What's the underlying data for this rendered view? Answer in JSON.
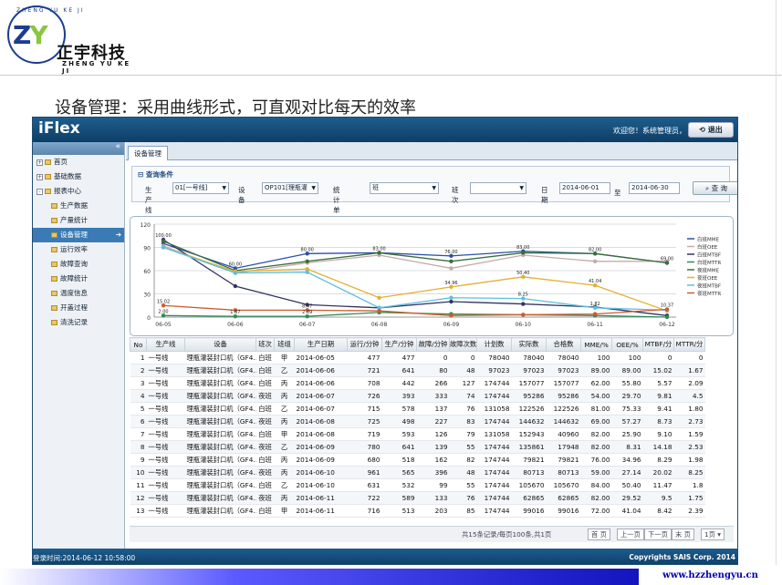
{
  "logo": {
    "arc_text": "ZHENG YU KE JI",
    "letters_z": "Z",
    "letters_y": "Y",
    "cn": "正宇科技",
    "en": "ZHENG YU KE JI"
  },
  "caption": "设备管理：采用曲线形式，可直观对比每天的效率",
  "app": {
    "brand": "iFlex",
    "welcome": "欢迎您！系统管理员，",
    "logout": "退出",
    "sidebar": {
      "collapse": "«",
      "items": [
        {
          "label": "首页",
          "level": 0,
          "toggle": "+"
        },
        {
          "label": "基础数据",
          "level": 0,
          "toggle": "+"
        },
        {
          "label": "报表中心",
          "level": 0,
          "toggle": "-"
        },
        {
          "label": "生产数据",
          "level": 1
        },
        {
          "label": "产量统计",
          "level": 1
        },
        {
          "label": "设备管理",
          "level": 1,
          "active": true
        },
        {
          "label": "运行效率",
          "level": 1
        },
        {
          "label": "故障查询",
          "level": 1
        },
        {
          "label": "故障统计",
          "level": 1
        },
        {
          "label": "温度信息",
          "level": 1
        },
        {
          "label": "开盖过程",
          "level": 1
        },
        {
          "label": "清洗记录",
          "level": 1
        }
      ]
    },
    "tab": "设备管理",
    "query": {
      "title": "查询条件",
      "line_label": "生产线",
      "line_value": "01[一号线]",
      "device_label": "设 备",
      "device_value": "OP101[理瓶灌",
      "unit_label": "统计单位",
      "unit_value": "班",
      "shift_label": "班次",
      "shift_value": "",
      "date_label": "日期",
      "date_from": "2014-06-01",
      "date_sep": "至",
      "date_to": "2014-06-30",
      "search": "查 询"
    },
    "chart_data": {
      "type": "line",
      "categories": [
        "06-05",
        "06-06",
        "06-07",
        "06-08",
        "06-09",
        "06-10",
        "06-11",
        "06-12"
      ],
      "ylim": [
        0,
        120
      ],
      "yticks": [
        0,
        30,
        60,
        90,
        120
      ],
      "grid": true,
      "legend_position": "right",
      "series": [
        {
          "name": "白班MME",
          "color": "#2b4fa8",
          "values": [
            95,
            63,
            82,
            83,
            79,
            85,
            82,
            70
          ]
        },
        {
          "name": "白班OEE",
          "color": "#c7a9a9",
          "values": [
            92,
            57,
            70,
            80,
            63,
            80,
            72,
            72
          ]
        },
        {
          "name": "白班MTBF",
          "color": "#333366",
          "values": [
            100,
            40,
            16,
            12,
            20,
            17,
            13,
            2
          ]
        },
        {
          "name": "白班MTTR",
          "color": "#2e8b57",
          "values": [
            2,
            1,
            1,
            6,
            4,
            3,
            2,
            0
          ]
        },
        {
          "name": "夜班MME",
          "color": "#3a6f3a",
          "values": [
            98,
            60,
            72,
            83,
            72,
            83,
            82,
            70
          ]
        },
        {
          "name": "夜班OEE",
          "color": "#e0b030",
          "values": [
            90,
            59,
            62,
            25,
            39,
            52,
            41,
            8
          ]
        },
        {
          "name": "夜班MTBF",
          "color": "#5bc0de",
          "values": [
            90,
            57,
            58,
            12,
            25,
            24,
            12,
            9
          ]
        },
        {
          "name": "夜班MTTR",
          "color": "#d05a2a",
          "values": [
            15,
            9,
            9,
            8,
            2,
            3,
            4,
            10
          ]
        }
      ],
      "data_labels": [
        "100.00",
        "60.00",
        "80.00",
        "83.00",
        "76.00",
        "83.00",
        "82.00",
        "69.00",
        "15.02",
        "8.47",
        "34.96",
        "50.40",
        "41.04",
        "10.37",
        "2.00",
        "1.67",
        "2.09",
        "8.25",
        "1.82"
      ]
    },
    "table": {
      "headers": [
        "No",
        "生产线",
        "设备",
        "班次",
        "班组",
        "生产日期",
        "运行/分钟",
        "生产/分钟",
        "故障/分钟",
        "故障次数",
        "计划数",
        "实际数",
        "合格数",
        "MME/%",
        "OEE/%",
        "MTBF/分",
        "MTTR/分"
      ],
      "rows": [
        [
          "1",
          "一号线",
          "理瓶灌装封口机（GF4…",
          "白班",
          "甲",
          "2014-06-05",
          "477",
          "477",
          "0",
          "0",
          "78040",
          "78040",
          "78040",
          "100",
          "100",
          "0",
          "0"
        ],
        [
          "2",
          "一号线",
          "理瓶灌装封口机（GF4…",
          "白班",
          "乙",
          "2014-06-06",
          "721",
          "641",
          "80",
          "48",
          "97023",
          "97023",
          "97023",
          "89.00",
          "89.00",
          "15.02",
          "1.67"
        ],
        [
          "3",
          "一号线",
          "理瓶灌装封口机（GF4…",
          "白班",
          "丙",
          "2014-06-06",
          "708",
          "442",
          "266",
          "127",
          "174744",
          "157077",
          "157077",
          "62.00",
          "55.80",
          "5.57",
          "2.09"
        ],
        [
          "4",
          "一号线",
          "理瓶灌装封口机（GF4…",
          "夜班",
          "丙",
          "2014-06-07",
          "726",
          "393",
          "333",
          "74",
          "174744",
          "95286",
          "95286",
          "54.00",
          "29.70",
          "9.81",
          "4.5"
        ],
        [
          "5",
          "一号线",
          "理瓶灌装封口机（GF4…",
          "白班",
          "乙",
          "2014-06-07",
          "715",
          "578",
          "137",
          "76",
          "131058",
          "122526",
          "122526",
          "81.00",
          "75.33",
          "9.41",
          "1.80"
        ],
        [
          "6",
          "一号线",
          "理瓶灌装封口机（GF4…",
          "夜班",
          "丙",
          "2014-06-08",
          "725",
          "498",
          "227",
          "83",
          "174744",
          "144632",
          "144632",
          "69.00",
          "57.27",
          "8.73",
          "2.73"
        ],
        [
          "7",
          "一号线",
          "理瓶灌装封口机（GF4…",
          "白班",
          "甲",
          "2014-06-08",
          "719",
          "593",
          "126",
          "79",
          "131058",
          "152943",
          "40960",
          "82.00",
          "25.90",
          "9.10",
          "1.59"
        ],
        [
          "8",
          "一号线",
          "理瓶灌装封口机（GF4…",
          "夜班",
          "乙",
          "2014-06-09",
          "780",
          "641",
          "139",
          "55",
          "174744",
          "135861",
          "17948",
          "82.00",
          "8.31",
          "14.18",
          "2.53"
        ],
        [
          "9",
          "一号线",
          "理瓶灌装封口机（GF4…",
          "白班",
          "丙",
          "2014-06-09",
          "680",
          "518",
          "162",
          "82",
          "174744",
          "79821",
          "79821",
          "76.00",
          "34.96",
          "8.29",
          "1.98"
        ],
        [
          "10",
          "一号线",
          "理瓶灌装封口机（GF4…",
          "夜班",
          "丙",
          "2014-06-10",
          "961",
          "565",
          "396",
          "48",
          "174744",
          "80713",
          "80713",
          "59.00",
          "27.14",
          "20.02",
          "8.25"
        ],
        [
          "11",
          "一号线",
          "理瓶灌装封口机（GF4…",
          "白班",
          "乙",
          "2014-06-10",
          "631",
          "532",
          "99",
          "55",
          "174744",
          "105670",
          "105670",
          "84.00",
          "50.40",
          "11.47",
          "1.8"
        ],
        [
          "12",
          "一号线",
          "理瓶灌装封口机（GF4…",
          "夜班",
          "丙",
          "2014-06-11",
          "722",
          "589",
          "133",
          "76",
          "174744",
          "62865",
          "62865",
          "82.00",
          "29.52",
          "9.5",
          "1.75"
        ],
        [
          "13",
          "一号线",
          "理瓶灌装封口机（GF4…",
          "白班",
          "甲",
          "2014-06-11",
          "716",
          "513",
          "203",
          "85",
          "174744",
          "99016",
          "99016",
          "72.00",
          "41.04",
          "8.42",
          "2.39"
        ]
      ]
    },
    "pager": {
      "info": "共15条记录/每页100条,共1页",
      "first": "首 页",
      "prev": "上一页",
      "next": "下一页",
      "last": "末 页",
      "size": "1页"
    },
    "footer": {
      "left": "登录时间:2014-06-12 10:58:00",
      "right": "Copyrights SAIS Corp. 2014"
    }
  },
  "website": "www.hzzhengyu.cn"
}
